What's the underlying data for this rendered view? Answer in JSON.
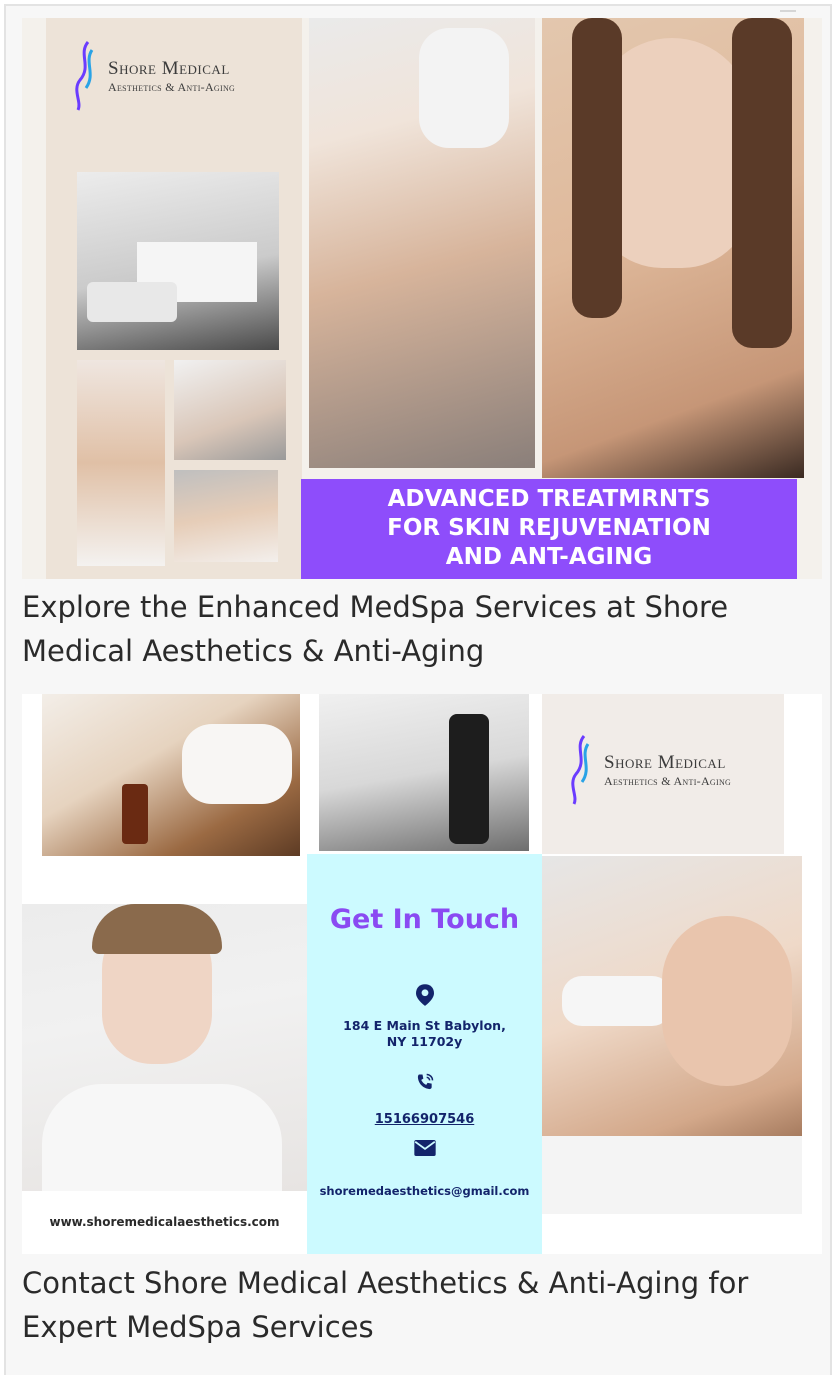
{
  "tiles": [
    {
      "logo": {
        "line1": "Shore Medical",
        "line2": "Aesthetics & Anti-Aging"
      },
      "banner_lines": [
        "ADVANCED TREATMRNTS",
        "FOR SKIN REJUVENATION",
        "AND ANT-AGING"
      ],
      "caption": "Explore the Enhanced MedSpa Services at Shore Medical Aesthetics & Anti-Aging"
    },
    {
      "logo": {
        "line1": "Shore Medical",
        "line2": "Aesthetics & Anti-Aging"
      },
      "contact": {
        "title": "Get In Touch",
        "address_line1": "184 E Main St Babylon,",
        "address_line2": "NY 11702y",
        "phone": "15166907546",
        "email": "shoremedaesthetics@gmail.com",
        "website": "www.shoremedicalaesthetics.com"
      },
      "caption": "Contact Shore Medical Aesthetics & Anti-Aging for Expert MedSpa Services"
    }
  ],
  "colors": {
    "banner": "#8e4dfb",
    "contact_bg": "#ccfaff",
    "contact_title": "#8a4af2",
    "contact_text": "#13246b"
  },
  "icons": [
    "location-pin-icon",
    "phone-icon",
    "envelope-icon"
  ]
}
